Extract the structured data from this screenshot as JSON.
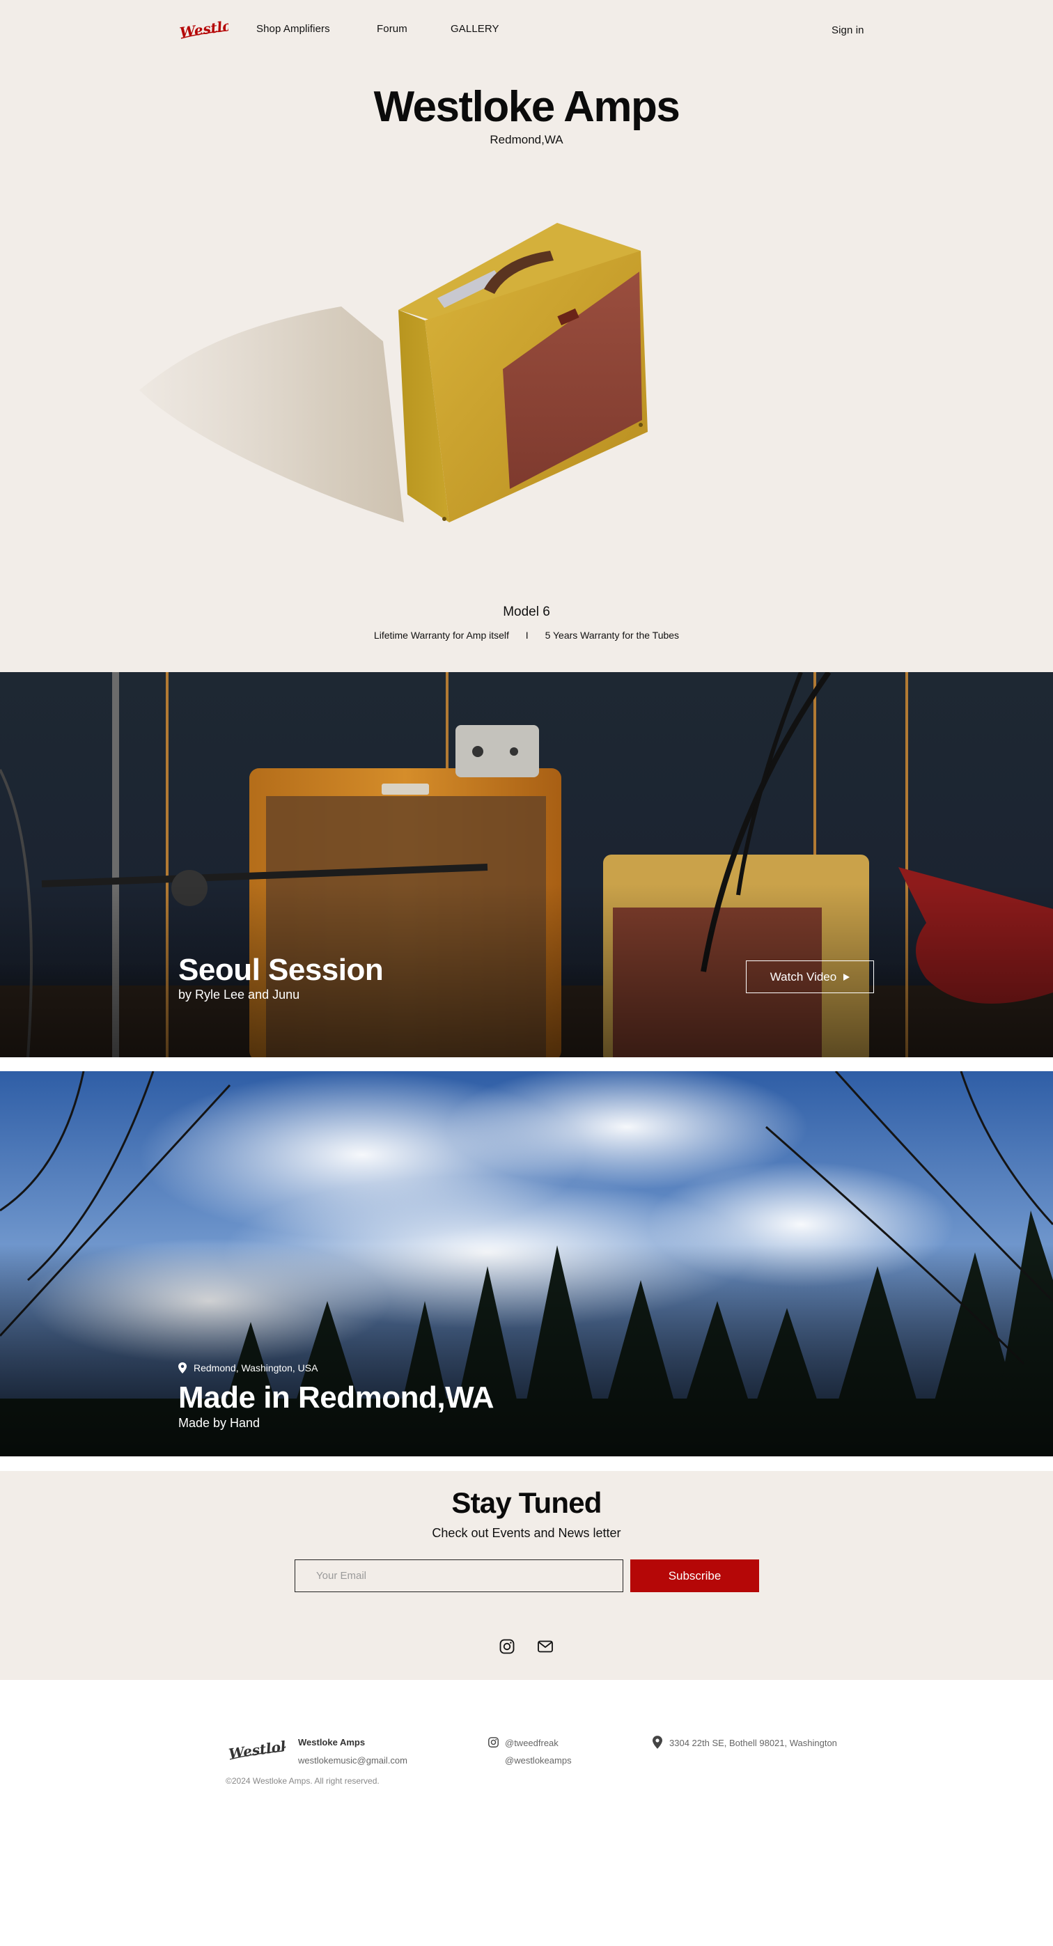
{
  "nav": {
    "logo_text": "Westloke",
    "links": [
      "Shop Amplifiers",
      "Forum",
      "GALLERY"
    ],
    "signin": "Sign in"
  },
  "hero": {
    "title": "Westloke Amps",
    "subtitle": "Redmond,WA",
    "model": "Model 6",
    "warranty_left": "Lifetime Warranty for Amp itself",
    "warranty_sep": "I",
    "warranty_right": "5 Years Warranty for the Tubes"
  },
  "session": {
    "title": "Seoul Session",
    "subtitle": "by Ryle Lee and Junu",
    "button": "Watch Video",
    "button_icon": "play-icon"
  },
  "redmond": {
    "location": "Redmond, Washington, USA",
    "location_icon": "map-pin-icon",
    "title": "Made in Redmond,WA",
    "subtitle": "Made by Hand"
  },
  "newsletter": {
    "title": "Stay Tuned",
    "subtitle": "Check out Events and News letter",
    "placeholder": "Your Email",
    "button": "Subscribe",
    "icons": [
      "instagram-icon",
      "mail-icon"
    ]
  },
  "footer": {
    "brand": "Westloke Amps",
    "email": "westlokemusic@gmail.com",
    "copyright": "©2024 Westloke Amps. All right reserved.",
    "instagram_1": "@tweedfreak",
    "instagram_2": "@westlokeamps",
    "address": "3304 22th SE, Bothell 98021, Washington"
  },
  "colors": {
    "hero_bg": "#f2ede8",
    "accent_red": "#b50707",
    "text_dark": "#111111"
  }
}
